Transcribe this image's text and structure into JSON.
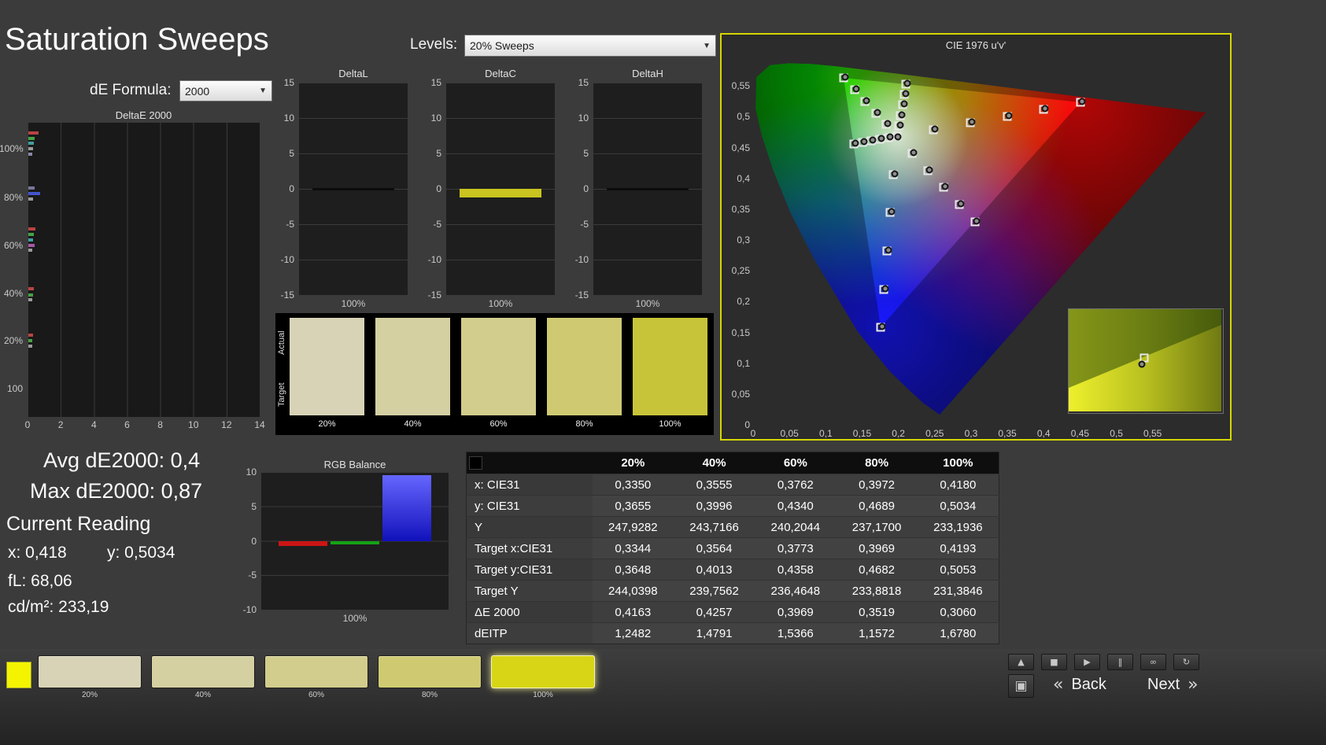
{
  "page": {
    "title": "Saturation Sweeps"
  },
  "controls": {
    "de_formula_label": "dE Formula:",
    "de_formula_value": "2000",
    "levels_label": "Levels:",
    "levels_value": "20% Sweeps"
  },
  "deltae_chart": {
    "title": "DeltaE 2000",
    "y_ticks": [
      "100%",
      "80%",
      "60%",
      "40%",
      "20%",
      "100"
    ],
    "x_ticks": [
      "0",
      "2",
      "4",
      "6",
      "8",
      "10",
      "12",
      "14"
    ],
    "bars": [
      {
        "top": 0.029,
        "width": 0.044,
        "color": "#b84444"
      },
      {
        "top": 0.047,
        "width": 0.027,
        "color": "#44a344"
      },
      {
        "top": 0.064,
        "width": 0.024,
        "color": "#3f9f9f"
      },
      {
        "top": 0.083,
        "width": 0.02,
        "color": "#9a9a9a"
      },
      {
        "top": 0.101,
        "width": 0.017,
        "color": "#8888aa"
      },
      {
        "top": 0.216,
        "width": 0.027,
        "color": "#777799"
      },
      {
        "top": 0.235,
        "width": 0.051,
        "color": "#4455cc"
      },
      {
        "top": 0.253,
        "width": 0.02,
        "color": "#9a9a9a"
      },
      {
        "top": 0.355,
        "width": 0.031,
        "color": "#b84444"
      },
      {
        "top": 0.373,
        "width": 0.024,
        "color": "#44a344"
      },
      {
        "top": 0.392,
        "width": 0.02,
        "color": "#3f9f9f"
      },
      {
        "top": 0.411,
        "width": 0.027,
        "color": "#a757a7"
      },
      {
        "top": 0.429,
        "width": 0.017,
        "color": "#9a9a9a"
      },
      {
        "top": 0.56,
        "width": 0.024,
        "color": "#b84444"
      },
      {
        "top": 0.579,
        "width": 0.02,
        "color": "#44a344"
      },
      {
        "top": 0.597,
        "width": 0.017,
        "color": "#9a9a9a"
      },
      {
        "top": 0.717,
        "width": 0.02,
        "color": "#b84444"
      },
      {
        "top": 0.736,
        "width": 0.017,
        "color": "#44a344"
      },
      {
        "top": 0.755,
        "width": 0.017,
        "color": "#9a9a9a"
      }
    ]
  },
  "delta_charts": [
    {
      "title": "DeltaL",
      "y_ticks": [
        "15",
        "10",
        "5",
        "0",
        "-5",
        "-10",
        "-15"
      ],
      "x_label": "100%",
      "bar": {
        "value": 0,
        "color": "#0c0c0c"
      }
    },
    {
      "title": "DeltaC",
      "y_ticks": [
        "15",
        "10",
        "5",
        "0",
        "-5",
        "-10",
        "-15"
      ],
      "x_label": "100%",
      "bar": {
        "value": -1.2,
        "color": "#c9c41f"
      }
    },
    {
      "title": "DeltaH",
      "y_ticks": [
        "15",
        "10",
        "5",
        "0",
        "-5",
        "-10",
        "-15"
      ],
      "x_label": "100%",
      "bar": {
        "value": 0,
        "color": "#0c0c0c"
      }
    }
  ],
  "swatch_panel": {
    "row_labels": [
      "Actual",
      "Target"
    ],
    "items": [
      {
        "label": "20%",
        "color": "#d8d3b6"
      },
      {
        "label": "40%",
        "color": "#d5d0a2"
      },
      {
        "label": "60%",
        "color": "#d2cd8c"
      },
      {
        "label": "80%",
        "color": "#cfca72"
      },
      {
        "label": "100%",
        "color": "#c8c439"
      }
    ]
  },
  "cie": {
    "title": "CIE 1976 u'v'",
    "x_tick_labels": [
      "0",
      "0,05",
      "0,1",
      "0,15",
      "0,2",
      "0,25",
      "0,3",
      "0,35",
      "0,4",
      "0,45",
      "0,5",
      "0,55"
    ],
    "y_tick_labels": [
      "0,55",
      "0,5",
      "0,45",
      "0,4",
      "0,35",
      "0,3",
      "0,25",
      "0,2",
      "0,15",
      "0,1",
      "0,05",
      "0"
    ],
    "white_point": [
      0.1978,
      0.4683
    ],
    "saturation_steps": [
      0.2,
      0.4,
      0.6,
      0.8,
      1.0
    ],
    "sweeps": [
      {
        "name": "red",
        "target": [
          0.4507,
          0.5229
        ]
      },
      {
        "name": "green",
        "target": [
          0.125,
          0.5625
        ]
      },
      {
        "name": "blue",
        "target": [
          0.1754,
          0.1579
        ]
      },
      {
        "name": "yellow",
        "target": [
          0.2105,
          0.5529
        ]
      },
      {
        "name": "cyan",
        "target": [
          0.1385,
          0.4557
        ]
      },
      {
        "name": "magenta",
        "target": [
          0.3053,
          0.3295
        ]
      }
    ]
  },
  "readings": {
    "avg_label": "Avg dE2000: 0,4",
    "max_label": "Max dE2000: 0,87",
    "current_title": "Current Reading",
    "x": "x: 0,418",
    "y": "y: 0,5034",
    "fl": "fL: 68,06",
    "luminance": "cd/m²: 233,19"
  },
  "rgb_balance": {
    "title": "RGB Balance",
    "y_ticks": [
      "10",
      "5",
      "0",
      "-5",
      "-10"
    ],
    "x_label": "100%",
    "bars": [
      {
        "name": "red",
        "value": -0.7,
        "color": "#cc1515"
      },
      {
        "name": "green",
        "value": -0.5,
        "color": "#15a315"
      },
      {
        "name": "blue",
        "value": 9.5,
        "color": "#2222dd"
      }
    ]
  },
  "table": {
    "headers": [
      "",
      "20%",
      "40%",
      "60%",
      "80%",
      "100%"
    ],
    "rows": [
      {
        "label": "x: CIE31",
        "values": [
          "0,3350",
          "0,3555",
          "0,3762",
          "0,3972",
          "0,4180"
        ]
      },
      {
        "label": "y: CIE31",
        "values": [
          "0,3655",
          "0,3996",
          "0,4340",
          "0,4689",
          "0,5034"
        ]
      },
      {
        "label": "Y",
        "values": [
          "247,9282",
          "243,7166",
          "240,2044",
          "237,1700",
          "233,1936"
        ]
      },
      {
        "label": "Target x:CIE31",
        "values": [
          "0,3344",
          "0,3564",
          "0,3773",
          "0,3969",
          "0,4193"
        ]
      },
      {
        "label": "Target y:CIE31",
        "values": [
          "0,3648",
          "0,4013",
          "0,4358",
          "0,4682",
          "0,5053"
        ]
      },
      {
        "label": "Target Y",
        "values": [
          "244,0398",
          "239,7562",
          "236,4648",
          "233,8818",
          "231,3846"
        ]
      },
      {
        "label": "ΔE 2000",
        "values": [
          "0,4163",
          "0,4257",
          "0,3969",
          "0,3519",
          "0,3060"
        ]
      },
      {
        "label": "dEITP",
        "values": [
          "1,2482",
          "1,4791",
          "1,5366",
          "1,1572",
          "1,6780"
        ]
      }
    ]
  },
  "bottom_bar": {
    "swatches": [
      {
        "label": "20%",
        "color": "#d8d3b6",
        "active": false
      },
      {
        "label": "40%",
        "color": "#d5d0a2",
        "active": false
      },
      {
        "label": "60%",
        "color": "#d2cd8c",
        "active": false
      },
      {
        "label": "80%",
        "color": "#cfca72",
        "active": false
      },
      {
        "label": "100%",
        "color": "#d8d516",
        "active": true
      }
    ],
    "transport_icons": [
      {
        "name": "collapse-icon",
        "glyph": "▲"
      },
      {
        "name": "stop-icon",
        "glyph": "■"
      },
      {
        "name": "play-icon",
        "glyph": "▶"
      },
      {
        "name": "pause-icon",
        "glyph": "‖"
      },
      {
        "name": "loop-icon",
        "glyph": "∞"
      },
      {
        "name": "refresh-icon",
        "glyph": "↻"
      }
    ],
    "layout_button_glyph": "▣",
    "back_chevron": "«",
    "back_label": "Back",
    "next_label": "Next",
    "next_chevron": "»"
  }
}
